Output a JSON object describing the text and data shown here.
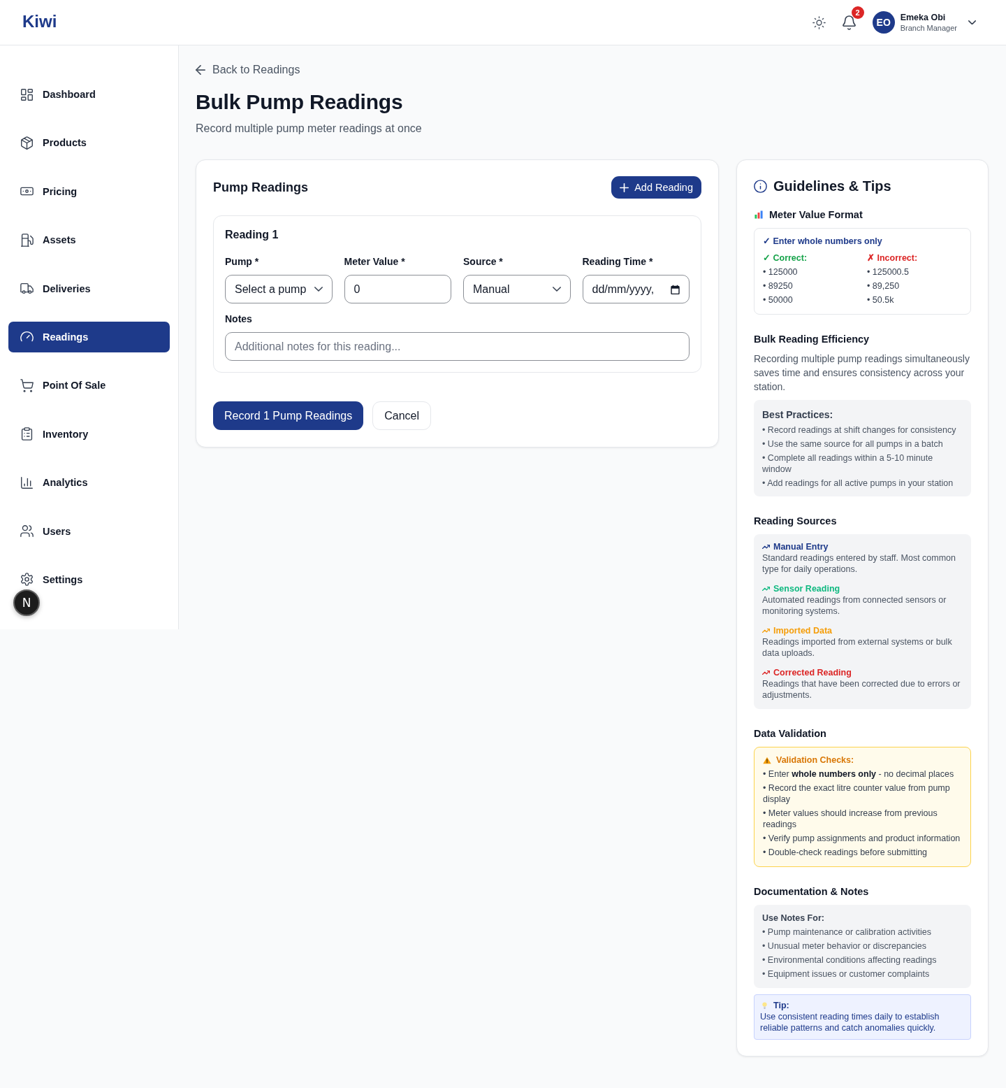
{
  "header": {
    "logo": "Kiwi",
    "notification_count": "2",
    "user": {
      "initials": "EO",
      "name": "Emeka Obi",
      "role": "Branch Manager"
    }
  },
  "sidebar": {
    "items": [
      {
        "label": "Dashboard",
        "selected": false
      },
      {
        "label": "Products",
        "selected": false
      },
      {
        "label": "Pricing",
        "selected": false
      },
      {
        "label": "Assets",
        "selected": false
      },
      {
        "label": "Deliveries",
        "selected": false
      },
      {
        "label": "Readings",
        "selected": true
      },
      {
        "label": "Point Of Sale",
        "selected": false
      },
      {
        "label": "Inventory",
        "selected": false
      },
      {
        "label": "Analytics",
        "selected": false
      },
      {
        "label": "Users",
        "selected": false
      },
      {
        "label": "Settings",
        "selected": false
      }
    ]
  },
  "dev_indicator": {
    "label": "N"
  },
  "back_link": "Back to Readings",
  "page": {
    "title": "Bulk Pump Readings",
    "subtitle": "Record multiple pump meter readings at once"
  },
  "form_card": {
    "title": "Pump Readings",
    "add_button": "Add Reading",
    "readings": [
      {
        "title": "Reading 1",
        "fields": [
          {
            "kind": "select",
            "label": "Pump *",
            "value": "Select a pump"
          },
          {
            "kind": "number",
            "label": "Meter Value *",
            "value": "0"
          },
          {
            "kind": "select",
            "label": "Source *",
            "value": "Manual"
          },
          {
            "kind": "date",
            "label": "Reading Time *",
            "value": "dd/mm/yyyy,"
          }
        ],
        "notes": {
          "label": "Notes",
          "placeholder": "Additional notes for this reading..."
        }
      }
    ],
    "submit_button": "Record 1 Pump Readings",
    "cancel_button": "Cancel"
  },
  "guidelines": {
    "title": "Guidelines & Tips",
    "meter_format": {
      "title": "Meter Value Format",
      "rule": "✓ Enter whole numbers only",
      "columns": [
        {
          "kind": "correct",
          "label": "✓ Correct:",
          "examples": [
            "• 125000",
            "• 89250",
            "• 50000"
          ]
        },
        {
          "kind": "incorrect",
          "label": "✗ Incorrect:",
          "examples": [
            "• 125000.5",
            "• 89,250",
            "• 50.5k"
          ]
        }
      ]
    },
    "efficiency": {
      "title": "Bulk Reading Efficiency",
      "text": "Recording multiple pump readings simultaneously saves time and ensures consistency across your station.",
      "box_title": "Best Practices:",
      "items": [
        "• Record readings at shift changes for consistency",
        "• Use the same source for all pumps in a batch",
        "• Complete all readings within a 5-10 minute window",
        "• Add readings for all active pumps in your station"
      ]
    },
    "sources": {
      "title": "Reading Sources",
      "items": [
        {
          "name": "Manual Entry",
          "description": "Standard readings entered by staff. Most common type for daily operations.",
          "color": "#1e3a8a"
        },
        {
          "name": "Sensor Reading",
          "description": "Automated readings from connected sensors or monitoring systems.",
          "color": "#10b981"
        },
        {
          "name": "Imported Data",
          "description": "Readings imported from external systems or bulk data uploads.",
          "color": "#f59e0b"
        },
        {
          "name": "Corrected Reading",
          "description": "Readings that have been corrected due to errors or adjustments.",
          "color": "#dc2626"
        }
      ]
    },
    "validation": {
      "title": "Data Validation",
      "box_title": "Validation Checks:",
      "items": [
        "• Enter **whole numbers only** - no decimal places",
        "• Record the exact litre counter value from pump display",
        "• Meter values should increase from previous readings",
        "• Verify pump assignments and product information",
        "• Double-check readings before submitting"
      ]
    },
    "documentation": {
      "title": "Documentation & Notes",
      "box_title": "Use Notes For:",
      "items": [
        "• Pump maintenance or calibration activities",
        "• Unusual meter behavior or discrepancies",
        "• Environmental conditions affecting readings",
        "• Equipment issues or customer complaints"
      ],
      "tip": {
        "title": "Tip:",
        "text": "Use consistent reading times daily to establish reliable patterns and catch anomalies quickly."
      }
    }
  }
}
